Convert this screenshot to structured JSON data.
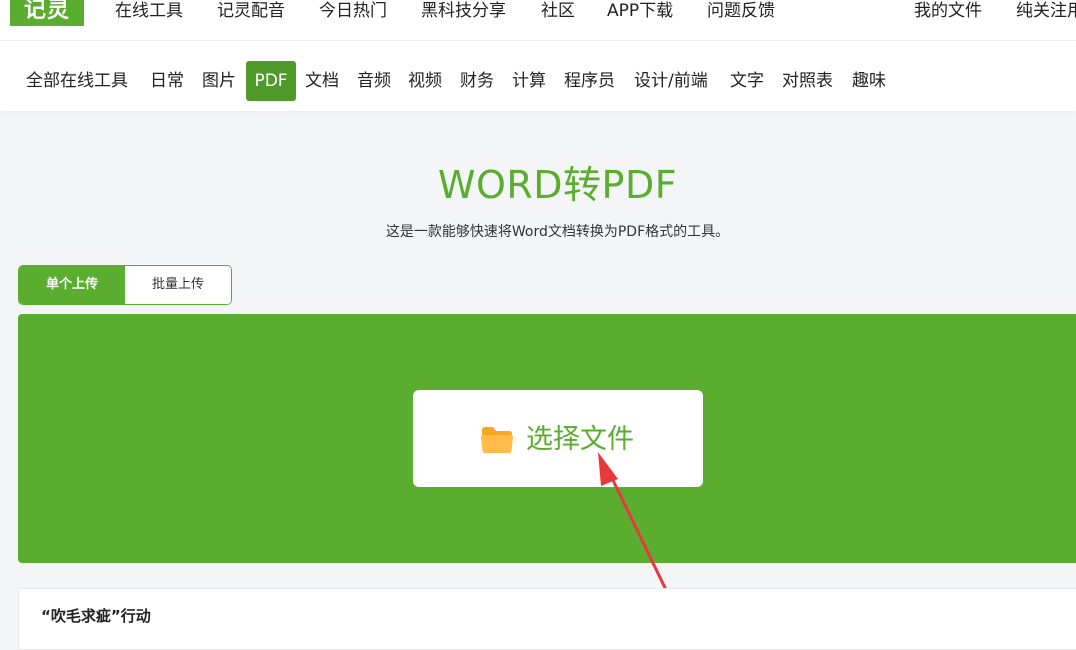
{
  "logo": {
    "text": "记灵"
  },
  "top_nav": {
    "links": [
      "在线工具",
      "记灵配音",
      "今日热门",
      "黑科技分享",
      "社区",
      "APP下载",
      "问题反馈"
    ],
    "right_links": [
      "我的文件",
      "纯关注用"
    ]
  },
  "categories": {
    "items": [
      "全部在线工具",
      "日常",
      "图片",
      "PDF",
      "文档",
      "音频",
      "视频",
      "财务",
      "计算",
      "程序员",
      "设计/前端",
      "文字",
      "对照表",
      "趣味"
    ],
    "active": "PDF"
  },
  "hero": {
    "title": "WORD转PDF",
    "subtitle": "这是一款能够快速将Word文档转换为PDF格式的工具。"
  },
  "upload_tabs": {
    "single": "单个上传",
    "batch": "批量上传",
    "active": "单个上传"
  },
  "upload": {
    "button_label": "选择文件",
    "icon": "folder-icon"
  },
  "bottom": {
    "title": "“吹毛求疵”行动"
  },
  "colors": {
    "brand_green": "#5aad2f",
    "active_tab_green": "#4f9a2a",
    "folder_orange": "#f6a623",
    "arrow_red": "#e8383d"
  }
}
